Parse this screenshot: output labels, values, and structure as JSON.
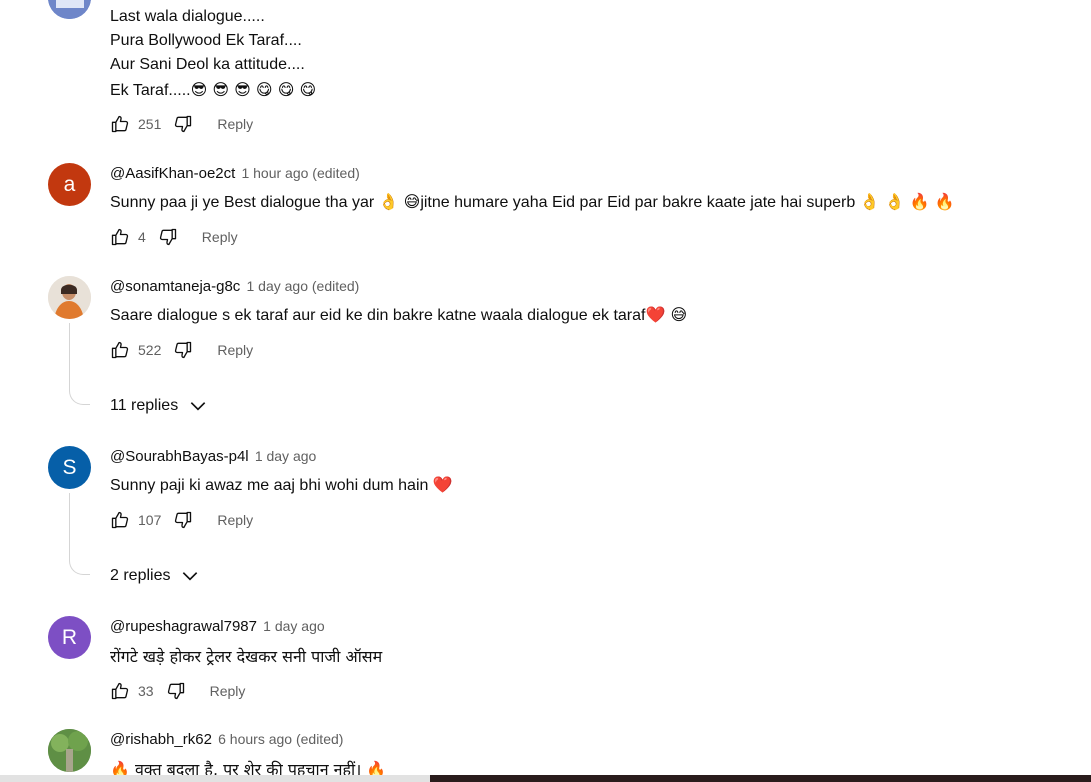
{
  "comments": [
    {
      "lines": [
        "Last wala dialogue.....",
        "Pura Bollywood Ek Taraf....",
        "Aur Sani Deol ka attitude....",
        "Ek Taraf....."
      ],
      "trail_emojis": "😎 😎 😎 😋 😋 😋",
      "likes": "251",
      "reply_label": "Reply"
    },
    {
      "handle": "@AasifKhan-oe2ct",
      "time": "1 hour ago (edited)",
      "avatar_letter": "a",
      "avatar_color": "#c2380f",
      "text_a": "Sunny paa ji ye Best dialogue tha yar ",
      "emoji_a": "👌 😅",
      "text_b": "jitne humare yaha Eid par Eid par bakre kaate jate hai superb ",
      "emoji_b": "👌 👌 🔥 🔥",
      "likes": "4",
      "reply_label": "Reply"
    },
    {
      "handle": "@sonamtaneja-g8c",
      "time": "1 day ago (edited)",
      "text": "Saare dialogue s ek taraf aur eid ke din bakre katne waala dialogue ek taraf",
      "emoji": "❤️ 😅",
      "likes": "522",
      "reply_label": "Reply",
      "replies": "11 replies"
    },
    {
      "handle": "@SourabhBayas-p4l",
      "time": "1 day ago",
      "avatar_letter": "S",
      "avatar_color": "#065fa8",
      "text": "Sunny paji ki awaz me aaj bhi wohi dum hain ",
      "emoji": "❤️",
      "likes": "107",
      "reply_label": "Reply",
      "replies": "2 replies"
    },
    {
      "handle": "@rupeshagrawal7987",
      "time": "1 day ago",
      "avatar_letter": "R",
      "avatar_color": "#7d4fc4",
      "text": "रोंगटे खड़े होकर ट्रेलर देखकर सनी पाजी ऑसम",
      "likes": "33",
      "reply_label": "Reply"
    },
    {
      "handle": "@rishabh_rk62",
      "time": "6 hours ago (edited)",
      "text": "वक्त बदला है, पर शेर की पहचान नहीं।",
      "emoji": "🔥"
    }
  ]
}
